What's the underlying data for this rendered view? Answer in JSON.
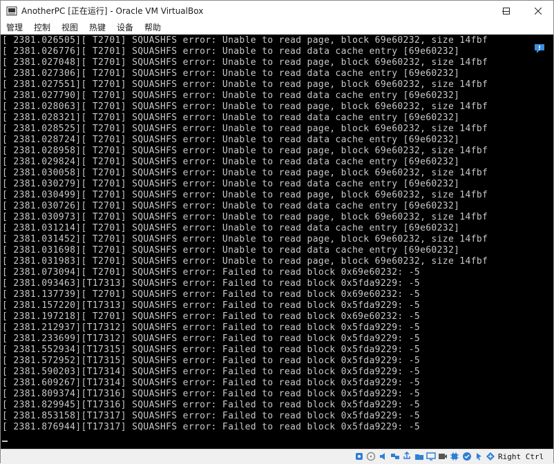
{
  "window": {
    "title": "AnotherPC [正在运行] - Oracle VM VirtualBox",
    "minimize_label": "—",
    "maximize_label": "☐",
    "close_label": "✕"
  },
  "menu": [
    {
      "label": "管理"
    },
    {
      "label": "控制"
    },
    {
      "label": "视图"
    },
    {
      "label": "热键"
    },
    {
      "label": "设备"
    },
    {
      "label": "帮助"
    }
  ],
  "console": {
    "lines": [
      "[ 2381.026505][ T2701] SQUASHFS error: Unable to read page, block 69e60232, size 14fbf",
      "[ 2381.026776][ T2701] SQUASHFS error: Unable to read data cache entry [69e60232]",
      "[ 2381.027048][ T2701] SQUASHFS error: Unable to read page, block 69e60232, size 14fbf",
      "[ 2381.027306][ T2701] SQUASHFS error: Unable to read data cache entry [69e60232]",
      "[ 2381.027551][ T2701] SQUASHFS error: Unable to read page, block 69e60232, size 14fbf",
      "[ 2381.027790][ T2701] SQUASHFS error: Unable to read data cache entry [69e60232]",
      "[ 2381.028063][ T2701] SQUASHFS error: Unable to read page, block 69e60232, size 14fbf",
      "[ 2381.028321][ T2701] SQUASHFS error: Unable to read data cache entry [69e60232]",
      "[ 2381.028525][ T2701] SQUASHFS error: Unable to read page, block 69e60232, size 14fbf",
      "[ 2381.028724][ T2701] SQUASHFS error: Unable to read data cache entry [69e60232]",
      "[ 2381.028958][ T2701] SQUASHFS error: Unable to read page, block 69e60232, size 14fbf",
      "[ 2381.029824][ T2701] SQUASHFS error: Unable to read data cache entry [69e60232]",
      "[ 2381.030058][ T2701] SQUASHFS error: Unable to read page, block 69e60232, size 14fbf",
      "[ 2381.030279][ T2701] SQUASHFS error: Unable to read data cache entry [69e60232]",
      "[ 2381.030499][ T2701] SQUASHFS error: Unable to read page, block 69e60232, size 14fbf",
      "[ 2381.030726][ T2701] SQUASHFS error: Unable to read data cache entry [69e60232]",
      "[ 2381.030973][ T2701] SQUASHFS error: Unable to read page, block 69e60232, size 14fbf",
      "[ 2381.031214][ T2701] SQUASHFS error: Unable to read data cache entry [69e60232]",
      "[ 2381.031452][ T2701] SQUASHFS error: Unable to read page, block 69e60232, size 14fbf",
      "[ 2381.031698][ T2701] SQUASHFS error: Unable to read data cache entry [69e60232]",
      "[ 2381.031983][ T2701] SQUASHFS error: Unable to read page, block 69e60232, size 14fbf",
      "[ 2381.073094][ T2701] SQUASHFS error: Failed to read block 0x69e60232: -5",
      "[ 2381.093463][T17313] SQUASHFS error: Failed to read block 0x5fda9229: -5",
      "[ 2381.137739][ T2701] SQUASHFS error: Failed to read block 0x69e60232: -5",
      "[ 2381.157220][T17313] SQUASHFS error: Failed to read block 0x5fda9229: -5",
      "[ 2381.197218][ T2701] SQUASHFS error: Failed to read block 0x69e60232: -5",
      "[ 2381.212937][T17312] SQUASHFS error: Failed to read block 0x5fda9229: -5",
      "[ 2381.233699][T17312] SQUASHFS error: Failed to read block 0x5fda9229: -5",
      "[ 2381.552934][T17315] SQUASHFS error: Failed to read block 0x5fda9229: -5",
      "[ 2381.572952][T17315] SQUASHFS error: Failed to read block 0x5fda9229: -5",
      "[ 2381.590203][T17314] SQUASHFS error: Failed to read block 0x5fda9229: -5",
      "[ 2381.609267][T17314] SQUASHFS error: Failed to read block 0x5fda9229: -5",
      "[ 2381.809374][T17316] SQUASHFS error: Failed to read block 0x5fda9229: -5",
      "[ 2381.829945][T17316] SQUASHFS error: Failed to read block 0x5fda9229: -5",
      "[ 2381.853158][T17317] SQUASHFS error: Failed to read block 0x5fda9229: -5",
      "[ 2381.876944][T17317] SQUASHFS error: Failed to read block 0x5fda9229: -5"
    ]
  },
  "statusbar": {
    "host_key": "Right Ctrl",
    "icons": [
      {
        "name": "hard-disk-icon",
        "color": "#2f7fd6"
      },
      {
        "name": "optical-drive-icon",
        "color": "#8d8d8d"
      },
      {
        "name": "audio-icon",
        "color": "#2f7fd6"
      },
      {
        "name": "network-icon",
        "color": "#2f7fd6"
      },
      {
        "name": "usb-icon",
        "color": "#2f7fd6"
      },
      {
        "name": "shared-folders-icon",
        "color": "#2f7fd6"
      },
      {
        "name": "display-icon",
        "color": "#2f7fd6"
      },
      {
        "name": "video-capture-icon",
        "color": "#555555"
      },
      {
        "name": "cpu-icon",
        "color": "#2f7fd6"
      },
      {
        "name": "virtualization-icon",
        "color": "#2f7fd6"
      },
      {
        "name": "mouse-integration-icon",
        "color": "#2f7fd6"
      },
      {
        "name": "keyboard-capture-icon",
        "color": "#2f7fd6"
      }
    ]
  },
  "colors": {
    "console_bg": "#000000",
    "console_text": "#c9c9c9",
    "accent": "#2f7fd6"
  }
}
